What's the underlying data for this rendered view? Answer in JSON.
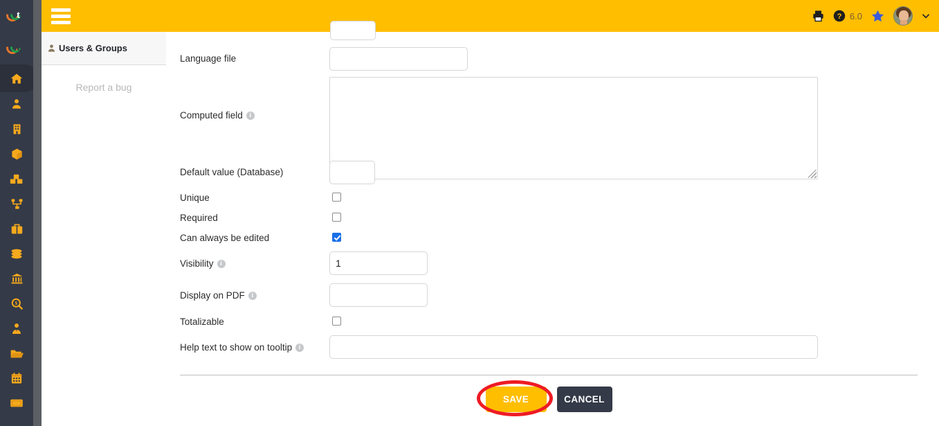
{
  "app": {
    "logo_name": "ct-logo",
    "accent_amber": "#ffbe00",
    "rail_bg": "#343a47",
    "checkbox_blue": "#1a6fe8",
    "annotation_red": "#ee1b24"
  },
  "header": {
    "menu_label": "menu",
    "version": "6.0",
    "icons": [
      "printer-icon",
      "help-icon",
      "star-icon",
      "avatar",
      "chevron-down-icon"
    ]
  },
  "rail": {
    "items": [
      {
        "name": "home",
        "active": true
      },
      {
        "name": "contacts",
        "active": false
      },
      {
        "name": "companies",
        "active": false
      },
      {
        "name": "products",
        "active": false
      },
      {
        "name": "stock",
        "active": false
      },
      {
        "name": "projects",
        "active": false
      },
      {
        "name": "commercial",
        "active": false
      },
      {
        "name": "billing",
        "active": false
      },
      {
        "name": "accounting",
        "active": false
      },
      {
        "name": "financial-search",
        "active": false
      },
      {
        "name": "hrm",
        "active": false
      },
      {
        "name": "documents",
        "active": false
      },
      {
        "name": "agenda",
        "active": false
      },
      {
        "name": "tickets",
        "active": false
      }
    ]
  },
  "tabpane": {
    "tab_label": "Users & Groups",
    "report_bug": "Report a bug"
  },
  "form": {
    "fields": [
      {
        "label": "Language file",
        "type": "text",
        "value": ""
      },
      {
        "label": "Computed field",
        "type": "textarea",
        "value": "",
        "has_info": true
      },
      {
        "label": "Default value (Database)",
        "type": "text",
        "value": ""
      },
      {
        "label": "Unique",
        "type": "checkbox",
        "checked": false
      },
      {
        "label": "Required",
        "type": "checkbox",
        "checked": false
      },
      {
        "label": "Can always be edited",
        "type": "checkbox",
        "checked": true
      },
      {
        "label": "Visibility",
        "type": "text",
        "value": "1",
        "has_info": true
      },
      {
        "label": "Display on PDF",
        "type": "text",
        "value": "",
        "has_info": true
      },
      {
        "label": "Totalizable",
        "type": "checkbox",
        "checked": false
      },
      {
        "label": "Help text to show on tooltip",
        "type": "text",
        "value": "",
        "has_info": true
      }
    ]
  },
  "buttons": {
    "save": "SAVE",
    "cancel": "CANCEL"
  }
}
